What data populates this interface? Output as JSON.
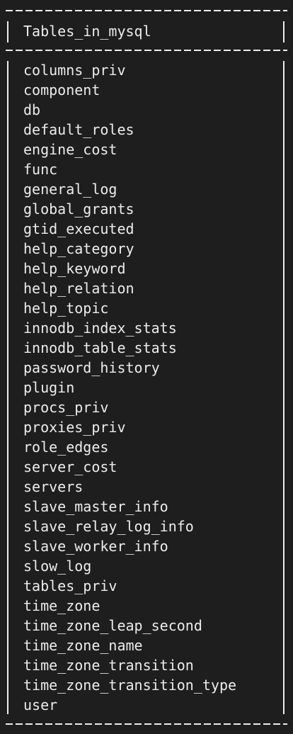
{
  "table": {
    "header": "Tables_in_mysql",
    "rows": [
      "columns_priv",
      "component",
      "db",
      "default_roles",
      "engine_cost",
      "func",
      "general_log",
      "global_grants",
      "gtid_executed",
      "help_category",
      "help_keyword",
      "help_relation",
      "help_topic",
      "innodb_index_stats",
      "innodb_table_stats",
      "password_history",
      "plugin",
      "procs_priv",
      "proxies_priv",
      "role_edges",
      "server_cost",
      "servers",
      "slave_master_info",
      "slave_relay_log_info",
      "slave_worker_info",
      "slow_log",
      "tables_priv",
      "time_zone",
      "time_zone_leap_second",
      "time_zone_name",
      "time_zone_transition",
      "time_zone_transition_type",
      "user"
    ]
  }
}
